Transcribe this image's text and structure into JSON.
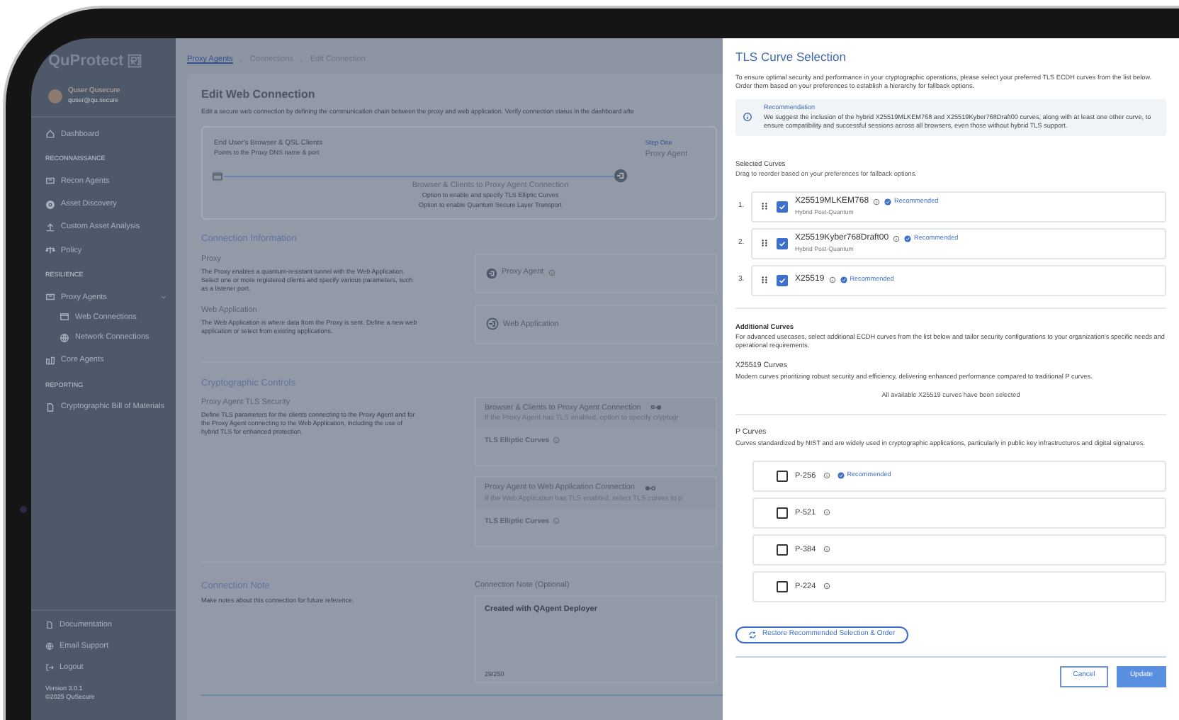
{
  "sidebar": {
    "brand": "QuProtect",
    "user": {
      "name": "Quser Qusecure",
      "email": "quser@qu.secure"
    },
    "nav": [
      {
        "kind": "item",
        "label": "Dashboard"
      },
      {
        "kind": "section",
        "label": "RECONNAISSANCE"
      },
      {
        "kind": "item",
        "label": "Recon Agents"
      },
      {
        "kind": "item",
        "label": "Asset Discovery"
      },
      {
        "kind": "item",
        "label": "Custom Asset Analysis"
      },
      {
        "kind": "item",
        "label": "Policy"
      },
      {
        "kind": "section",
        "label": "RESILIENCE"
      },
      {
        "kind": "item",
        "label": "Proxy Agents",
        "expanded": true,
        "children": [
          {
            "label": "Web Connections"
          },
          {
            "label": "Network Connections"
          }
        ]
      },
      {
        "kind": "item",
        "label": "Core Agents"
      },
      {
        "kind": "section",
        "label": "REPORTING"
      },
      {
        "kind": "item",
        "label": "Cryptographic Bill of Materials"
      }
    ],
    "footer": [
      {
        "label": "Documentation"
      },
      {
        "label": "Email Support"
      },
      {
        "label": "Logout"
      }
    ],
    "version": "Version 3.0.1",
    "copyright": "©2025 QuSecure"
  },
  "breadcrumb": [
    "Proxy Agents",
    "Connections",
    "Edit Connection"
  ],
  "card": {
    "title": "Edit Web Connection",
    "description": "Edit a secure web connection by defining the communication chain between the proxy and web application. Verify connection status in the dashboard afte",
    "diagram": {
      "source_title": "End User's Browser & QSL Clients",
      "source_subtitle": "Points to the Proxy DNS name & port",
      "step": "Step One",
      "target": "Proxy Agent",
      "link_title": "Browser & Clients to Proxy Agent Connection",
      "link_lines": [
        "Option to enable and specify TLS Elliptic Curves",
        "Option to enable Quantum Secure Layer Transport"
      ]
    },
    "connection_information": {
      "heading": "Connection Information",
      "rows": [
        {
          "title": "Proxy",
          "description": "The Proxy enables a quantum-resistant tunnel with the Web Application. Select one or more registered clients and specify various parameters, such as a listener port.",
          "value": "Proxy Agent"
        },
        {
          "title": "Web Application",
          "description": "The Web Application is where data from the Proxy is sent. Define a new web application or select from existing applications.",
          "value": "Web Application"
        }
      ]
    },
    "cryptographic_controls": {
      "heading": "Cryptographic Controls",
      "title": "Proxy Agent TLS Security",
      "description": "Define TLS parameters for the clients connecting to the Proxy Agent and for the Proxy Agent connecting to the Web Application, including the use of hybrid TLS for enhanced protection.",
      "connections": [
        {
          "title": "Browser & Clients to Proxy Agent Connection",
          "note": "If the Proxy Agent has TLS enabled, option to specify cryptogr",
          "field": "TLS Elliptic Curves"
        },
        {
          "title": "Proxy Agent to Web Application Connection",
          "note": "If the Web Application has TLS enabled, select TLS curves to p",
          "field": "TLS Elliptic Curves"
        }
      ]
    },
    "connection_note": {
      "heading": "Connection Note",
      "description": "Make notes about this connection for future reference.",
      "label": "Connection Note (Optional)",
      "value": "Created with QAgent Deployer",
      "count": "29/250"
    }
  },
  "panel": {
    "title": "TLS Curve Selection",
    "intro": "To ensure optimal security and performance in your cryptographic operations, please select your preferred TLS ECDH curves from the list below. Order them based on your preferences to establish a hierarchy for fallback options.",
    "recommendation": {
      "title": "Recommendation",
      "text": "We suggest the inclusion of the hybrid X25519MLKEM768 and X25519Kyber768Draft00 curves, along with at least one other curve, to ensure compatibility and successful sessions across all browsers, even those without hybrid TLS support."
    },
    "selected_heading": "Selected Curves",
    "selected_hint": "Drag to reorder based on your preferences for fallback options.",
    "selected": [
      {
        "index": "1.",
        "name": "X25519MLKEM768",
        "subtitle": "Hybrid Post-Quantum",
        "badge": "Recommended",
        "checked": true
      },
      {
        "index": "2.",
        "name": "X25519Kyber768Draft00",
        "subtitle": "Hybrid Post-Quantum",
        "badge": "Recommended",
        "checked": true
      },
      {
        "index": "3.",
        "name": "X25519",
        "badge": "Recommended",
        "checked": true
      }
    ],
    "additional_heading": "Additional Curves",
    "additional_text": "For advanced usecases, select additional ECDH curves from the list below and tailor security configurations to your organization's specific needs and operational requirements.",
    "groups": [
      {
        "title": "X25519 Curves",
        "description": "Modern curves prioritizing robust security and efficiency, delivering enhanced performance compared to traditional P curves.",
        "empty": "All available X25519 curves have been selected"
      },
      {
        "title": "P Curves",
        "description": "Curves standardized by NIST and are widely used in cryptographic applications, particularly in public key infrastructures and digital signatures.",
        "curves": [
          {
            "name": "P-256",
            "badge": "Recommended",
            "checked": false
          },
          {
            "name": "P-521",
            "checked": false
          },
          {
            "name": "P-384",
            "checked": false
          },
          {
            "name": "P-224",
            "checked": false
          }
        ]
      }
    ],
    "restore": "Restore Recommended Selection & Order",
    "cancel": "Cancel",
    "update": "Update"
  }
}
